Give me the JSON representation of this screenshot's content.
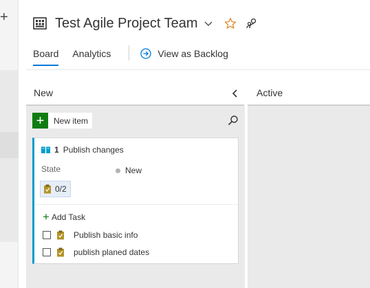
{
  "header": {
    "team_name": "Test Agile Project Team"
  },
  "tabs": [
    {
      "label": "Board"
    },
    {
      "label": "Analytics"
    }
  ],
  "backlog_link": {
    "label": "View as Backlog"
  },
  "columns": [
    {
      "name": "New"
    },
    {
      "name": "Active"
    }
  ],
  "new_item": {
    "label": "New item"
  },
  "card": {
    "id": "1",
    "title": "Publish changes",
    "state_label": "State",
    "state_value": "New",
    "task_progress": "0/2",
    "add_task_label": "Add Task",
    "tasks": [
      {
        "label": "Publish basic info"
      },
      {
        "label": "publish planed dates"
      }
    ]
  },
  "colors": {
    "accent": "#0078d4",
    "card_stripe": "#009ccc",
    "new_item_green": "#107c10",
    "favorite_star": "#e08a2a",
    "task_clip": "#b39428"
  },
  "icons": {
    "team": "team-grid-icon",
    "chevron": "chevron-down-icon",
    "favorite": "star-icon",
    "members": "people-icon",
    "backlog": "circle-arrow-icon",
    "collapse": "chevron-left-icon",
    "search": "search-icon",
    "work_item": "book-icon",
    "task": "clipboard-icon"
  }
}
